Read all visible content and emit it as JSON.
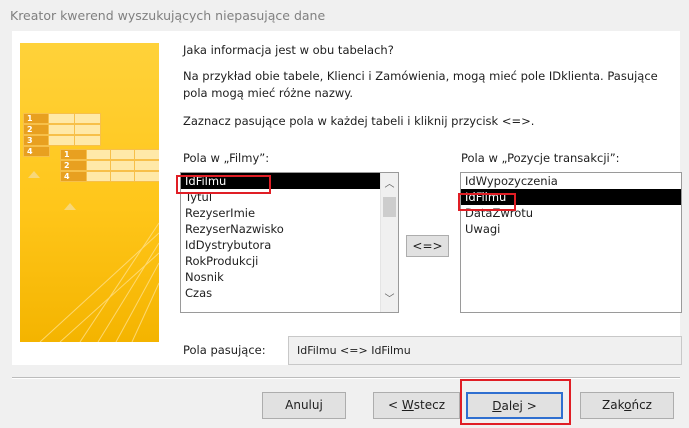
{
  "window": {
    "title": "Kreator kwerend wyszukujących niepasujące dane"
  },
  "header": {
    "question": "Jaka informacja jest w obu tabelach?",
    "description": "Na przykład obie tabele, Klienci i Zamówienia, mogą mieć pole IDklienta. Pasujące pola mogą mieć różne nazwy.",
    "instruction": "Zaznacz pasujące pola w każdej tabeli i kliknij przycisk <=>."
  },
  "illustration": {
    "left_numbers": [
      "1",
      "2",
      "3",
      "4"
    ],
    "right_numbers": [
      "1",
      "2",
      "4"
    ]
  },
  "left_table": {
    "label": "Pola w „Filmy”:",
    "items": [
      "IdFilmu",
      "Tytul",
      "RezyserImie",
      "RezyserNazwisko",
      "IdDystrybutora",
      "RokProdukcji",
      "Nosnik",
      "Czas"
    ],
    "selected": "IdFilmu"
  },
  "right_table": {
    "label": "Pola w „Pozycje transakcji”:",
    "items": [
      "IdWypozyczenia",
      "IdFilmu",
      "DataZwrotu",
      "Uwagi"
    ],
    "selected": "IdFilmu"
  },
  "swap_button": {
    "label": "<=>"
  },
  "matching": {
    "label": "Pola pasujące:",
    "value": "IdFilmu <=> IdFilmu"
  },
  "buttons": {
    "cancel": "Anuluj",
    "back_prefix": "< ",
    "back_accel": "W",
    "back_rest": "stecz",
    "next_accel": "D",
    "next_rest": "alej >",
    "finish_prefix": "Zak",
    "finish_accel": "o",
    "finish_rest": "ńcz"
  },
  "colors": {
    "highlight": "#e01e25",
    "selection": "#000000",
    "default_button_border": "#2f6fd0"
  },
  "icons": {
    "scroll_up": "chevron-up-icon",
    "scroll_down": "chevron-down-icon"
  }
}
